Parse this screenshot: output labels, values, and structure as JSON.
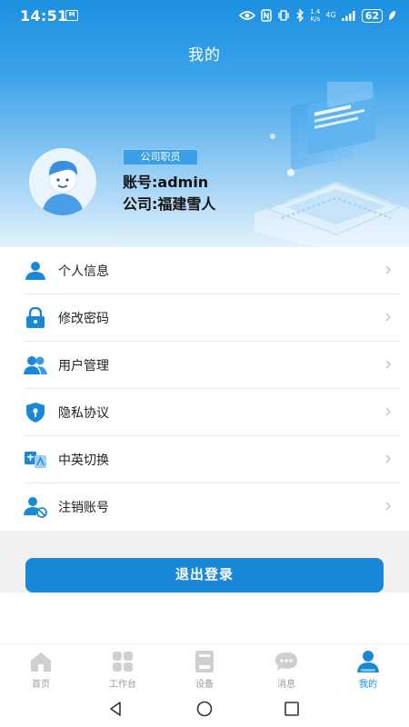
{
  "status_bar": {
    "time": "14:51",
    "left_icon": "M",
    "network": "4G",
    "speed_top": "1.4",
    "speed_bottom": "K/s",
    "battery": "62"
  },
  "header": {
    "title": "我的"
  },
  "profile": {
    "role": "公司职员",
    "account": "账号:admin",
    "company": "公司:福建雪人"
  },
  "menu": [
    {
      "label": "个人信息",
      "icon": "person-icon"
    },
    {
      "label": "修改密码",
      "icon": "lock-icon"
    },
    {
      "label": "用户管理",
      "icon": "users-icon"
    },
    {
      "label": "隐私协议",
      "icon": "shield-icon"
    },
    {
      "label": "中英切换",
      "icon": "language-icon"
    },
    {
      "label": "注销账号",
      "icon": "user-remove-icon"
    }
  ],
  "logout_label": "退出登录",
  "tabs": [
    {
      "label": "首页",
      "icon": "home-icon",
      "active": false
    },
    {
      "label": "工作台",
      "icon": "grid-icon",
      "active": false
    },
    {
      "label": "设备",
      "icon": "device-icon",
      "active": false
    },
    {
      "label": "消息",
      "icon": "message-icon",
      "active": false
    },
    {
      "label": "我的",
      "icon": "profile-icon",
      "active": true
    }
  ],
  "colors": {
    "primary": "#1a88d8",
    "inactive": "#9a9a9a"
  }
}
